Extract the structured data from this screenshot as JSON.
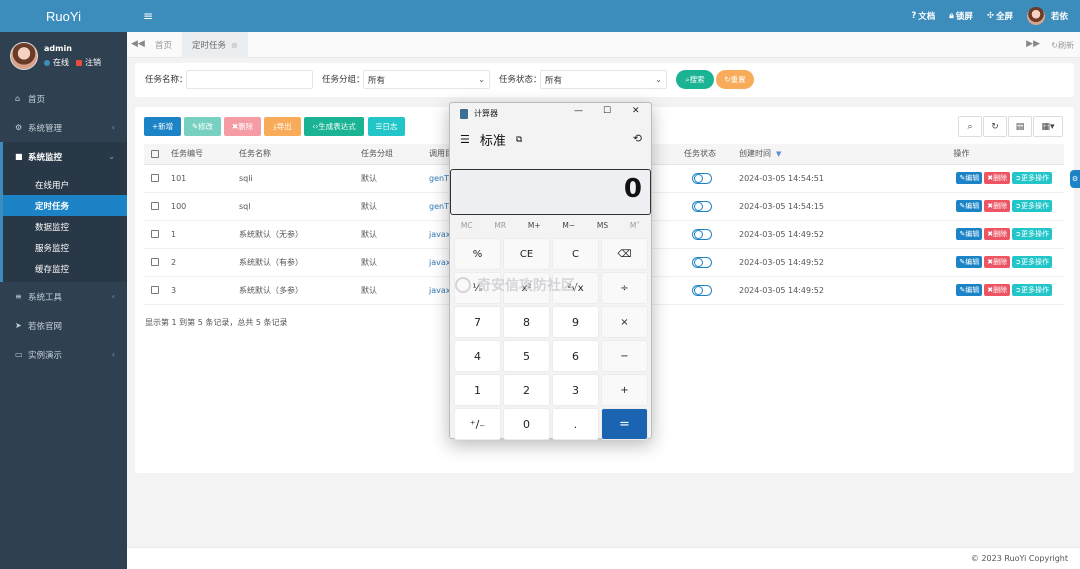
{
  "app": {
    "brand": "RuoYi"
  },
  "user": {
    "name": "admin",
    "status": "在线",
    "logout": "注销"
  },
  "sidebar": {
    "items": [
      {
        "label": "首页",
        "icon": "home-icon"
      },
      {
        "label": "系统管理",
        "icon": "gear-icon"
      },
      {
        "label": "系统监控",
        "icon": "video-icon"
      },
      {
        "label": "系统工具",
        "icon": "bars-icon"
      },
      {
        "label": "若依官网",
        "icon": "send-icon"
      },
      {
        "label": "实例演示",
        "icon": "desktop-icon"
      }
    ],
    "submenu": [
      "在线用户",
      "定时任务",
      "数据监控",
      "服务监控",
      "缓存监控"
    ]
  },
  "topbar": {
    "doc": "文档",
    "lock": "锁屏",
    "fullscreen": "全屏",
    "user": "若依"
  },
  "tabs": {
    "home": "首页",
    "active": "定时任务",
    "refresh": "刷新"
  },
  "search": {
    "job_name_label": "任务名称：",
    "job_name_value": "",
    "job_group_label": "任务分组：",
    "job_group_value": "所有",
    "job_status_label": "任务状态：",
    "job_status_value": "所有",
    "search_btn": "搜索",
    "reset_btn": "重置"
  },
  "toolbar": {
    "add": "新增",
    "edit": "修改",
    "delete": "删除",
    "export": "导出",
    "cron": "生成表达式",
    "log": "日志"
  },
  "table": {
    "headers": [
      "任务编号",
      "任务名称",
      "任务分组",
      "调用目标",
      "任务状态",
      "创建时间",
      "操作"
    ],
    "rows": [
      {
        "id": "101",
        "name": "sqli",
        "group": "默认",
        "target": "genT",
        "created": "2024-03-05 14:54:51"
      },
      {
        "id": "100",
        "name": "sql",
        "group": "默认",
        "target": "genT",
        "created": "2024-03-05 14:54:15"
      },
      {
        "id": "1",
        "name": "系统默认（无参）",
        "group": "默认",
        "target": "javax",
        "created": "2024-03-05 14:49:52"
      },
      {
        "id": "2",
        "name": "系统默认（有参）",
        "group": "默认",
        "target": "javax",
        "created": "2024-03-05 14:49:52"
      },
      {
        "id": "3",
        "name": "系统默认（多参）",
        "group": "默认",
        "target": "javax",
        "created": "2024-03-05 14:49:52"
      }
    ],
    "row_actions": {
      "edit": "编辑",
      "delete": "删除",
      "more": "更多操作"
    },
    "pager": "显示第 1 到第 5 条记录，总共 5 条记录"
  },
  "footer": {
    "copyright": "© 2023 RuoYi Copyright"
  },
  "calculator": {
    "title": "计算器",
    "mode": "标准",
    "display": "0",
    "memory": [
      "MC",
      "MR",
      "M+",
      "M−",
      "MS",
      "M˅"
    ],
    "keys": [
      "%",
      "CE",
      "C",
      "⌫",
      "¹⁄ₓ",
      "x²",
      "²√x",
      "÷",
      "7",
      "8",
      "9",
      "×",
      "4",
      "5",
      "6",
      "−",
      "1",
      "2",
      "3",
      "+",
      "⁺/₋",
      "0",
      ".",
      "="
    ]
  },
  "watermark": "奇安信攻防社区",
  "colors": {
    "primary": "#3c8dbc",
    "sidebar": "#2f4050",
    "accent_blue": "#1c84c6",
    "success": "#1ab394",
    "danger": "#ed5565",
    "warning": "#f8ac59"
  }
}
